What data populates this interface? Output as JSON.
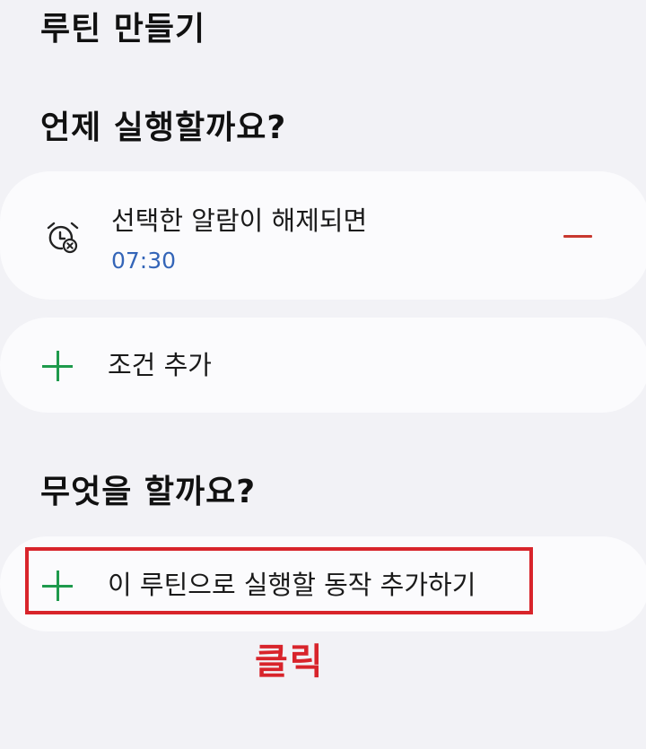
{
  "page": {
    "title": "루틴 만들기"
  },
  "when_section": {
    "heading": "언제 실행할까요?",
    "condition": {
      "icon": "alarm-dismiss-icon",
      "label": "선택한 알람이 해제되면",
      "time": "07:30",
      "remove_icon": "minus-icon"
    },
    "add_condition": {
      "icon": "plus-icon",
      "label": "조건 추가"
    }
  },
  "what_section": {
    "heading": "무엇을 할까요?",
    "add_action": {
      "icon": "plus-icon",
      "label": "이 루틴으로 실행할 동작 추가하기"
    }
  },
  "annotation": {
    "label": "클릭"
  },
  "colors": {
    "background": "#f2f2f6",
    "card": "#fbfbfd",
    "accent_green": "#1e9a4c",
    "time_blue": "#3465b8",
    "remove_red": "#c8382f",
    "annotation_red": "#d8242b"
  }
}
